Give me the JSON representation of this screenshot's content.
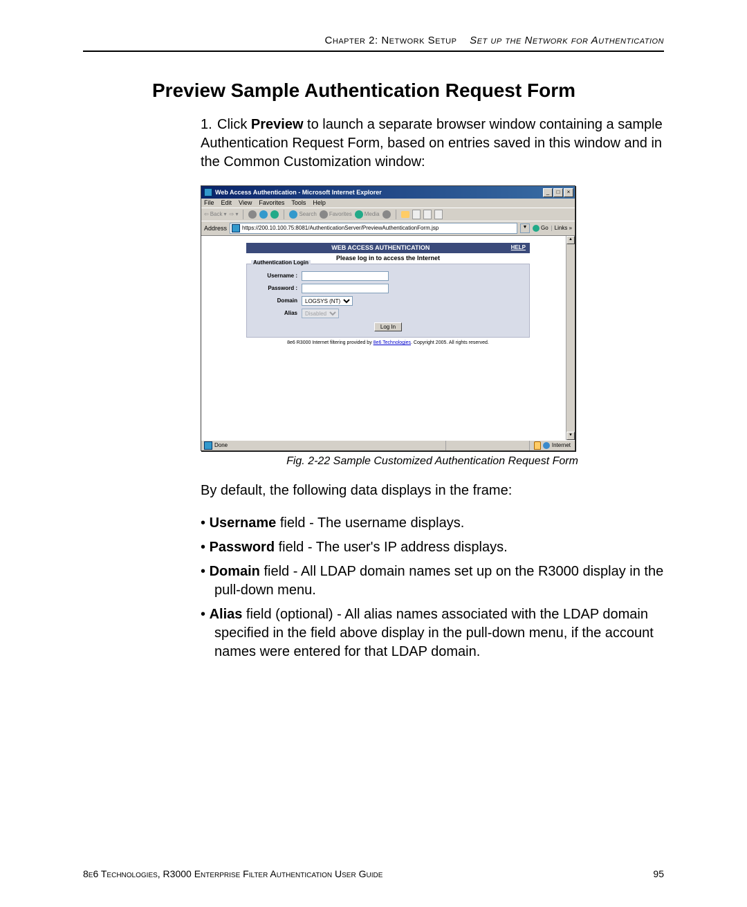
{
  "header": {
    "chapter": "Chapter 2: Network Setup",
    "section": "Set up the Network for Authentication"
  },
  "title": "Preview Sample Authentication Request Form",
  "step1": {
    "num": "1.",
    "pre": "Click ",
    "bold": "Preview",
    "post": " to launch a separate browser window containing a sample Authentication Request Form, based on entries saved in this window and in the Common Customization window:"
  },
  "figure_caption": "Fig. 2-22  Sample Customized Authentication Request Form",
  "para_default": "By default, the following data displays in the frame:",
  "bullets": [
    {
      "b": "Username",
      "t": " field - The username displays."
    },
    {
      "b": "Password",
      "t": " field - The user's IP address displays."
    },
    {
      "b": "Domain",
      "t": " field - All LDAP domain names set up on the R3000 display in the pull-down menu."
    },
    {
      "b": "Alias",
      "t": " field (optional) - All alias names associated with the LDAP domain specified in the field above display in the pull-down menu, if the account names were entered for that LDAP domain."
    }
  ],
  "footer": {
    "left": "8e6 Technologies, R3000 Enterprise Filter Authentication User Guide",
    "page": "95"
  },
  "screenshot": {
    "window_title": "Web Access Authentication - Microsoft Internet Explorer",
    "menus": [
      "File",
      "Edit",
      "View",
      "Favorites",
      "Tools",
      "Help"
    ],
    "toolbar": {
      "back": "Back",
      "search": "Search",
      "favorites": "Favorites",
      "media": "Media"
    },
    "address_label": "Address",
    "address_url": "https://200.10.100.75:8081/AuthenticationServer/PreviewAuthenticationForm.jsp",
    "go": "Go",
    "links": "Links »",
    "auth": {
      "header": "WEB ACCESS AUTHENTICATION",
      "help": "HELP",
      "subtitle": "Please log in to access the Internet",
      "legend": "Authentication Login",
      "username_label": "Username :",
      "password_label": "Password :",
      "domain_label": "Domain",
      "domain_value": "LOGSYS (NT)",
      "alias_label": "Alias",
      "alias_value": "Disabled",
      "login_btn": "Log In",
      "foot_pre": "8e6 R3000 Internet filtering provided by ",
      "foot_link": "8e6 Technologies",
      "foot_post": ". Copyright 2005. All rights reserved."
    },
    "status": {
      "done": "Done",
      "zone": "Internet"
    }
  }
}
